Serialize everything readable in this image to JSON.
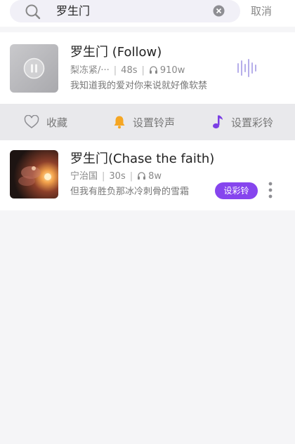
{
  "search": {
    "query": "罗生门",
    "cancel_label": "取消"
  },
  "results": [
    {
      "title": "罗生门 (Follow)",
      "artist": "梨冻紧/···",
      "duration": "48s",
      "plays": "910w",
      "lyric": "我知道我的爱对你来说就好像软禁",
      "state": "playing"
    },
    {
      "title": "罗生门(Chase the faith)",
      "artist": "宁治国",
      "duration": "30s",
      "plays": "8w",
      "lyric": "但我有胜负那冰冷刺骨的雪霜",
      "action_label": "设彩铃"
    }
  ],
  "actions": {
    "favorite": "收藏",
    "ringtone": "设置铃声",
    "color_ring": "设置彩铃"
  },
  "colors": {
    "accent": "#8645ee",
    "bell": "#f5a623",
    "note": "#7b3fe4"
  },
  "icons": {
    "search": "search-icon",
    "clear": "clear-icon",
    "pause": "pause-icon",
    "wave": "sound-wave-icon",
    "heart": "heart-icon",
    "bell": "bell-icon",
    "note": "music-note-icon",
    "headphones": "headphones-icon",
    "more": "more-vertical-icon"
  }
}
